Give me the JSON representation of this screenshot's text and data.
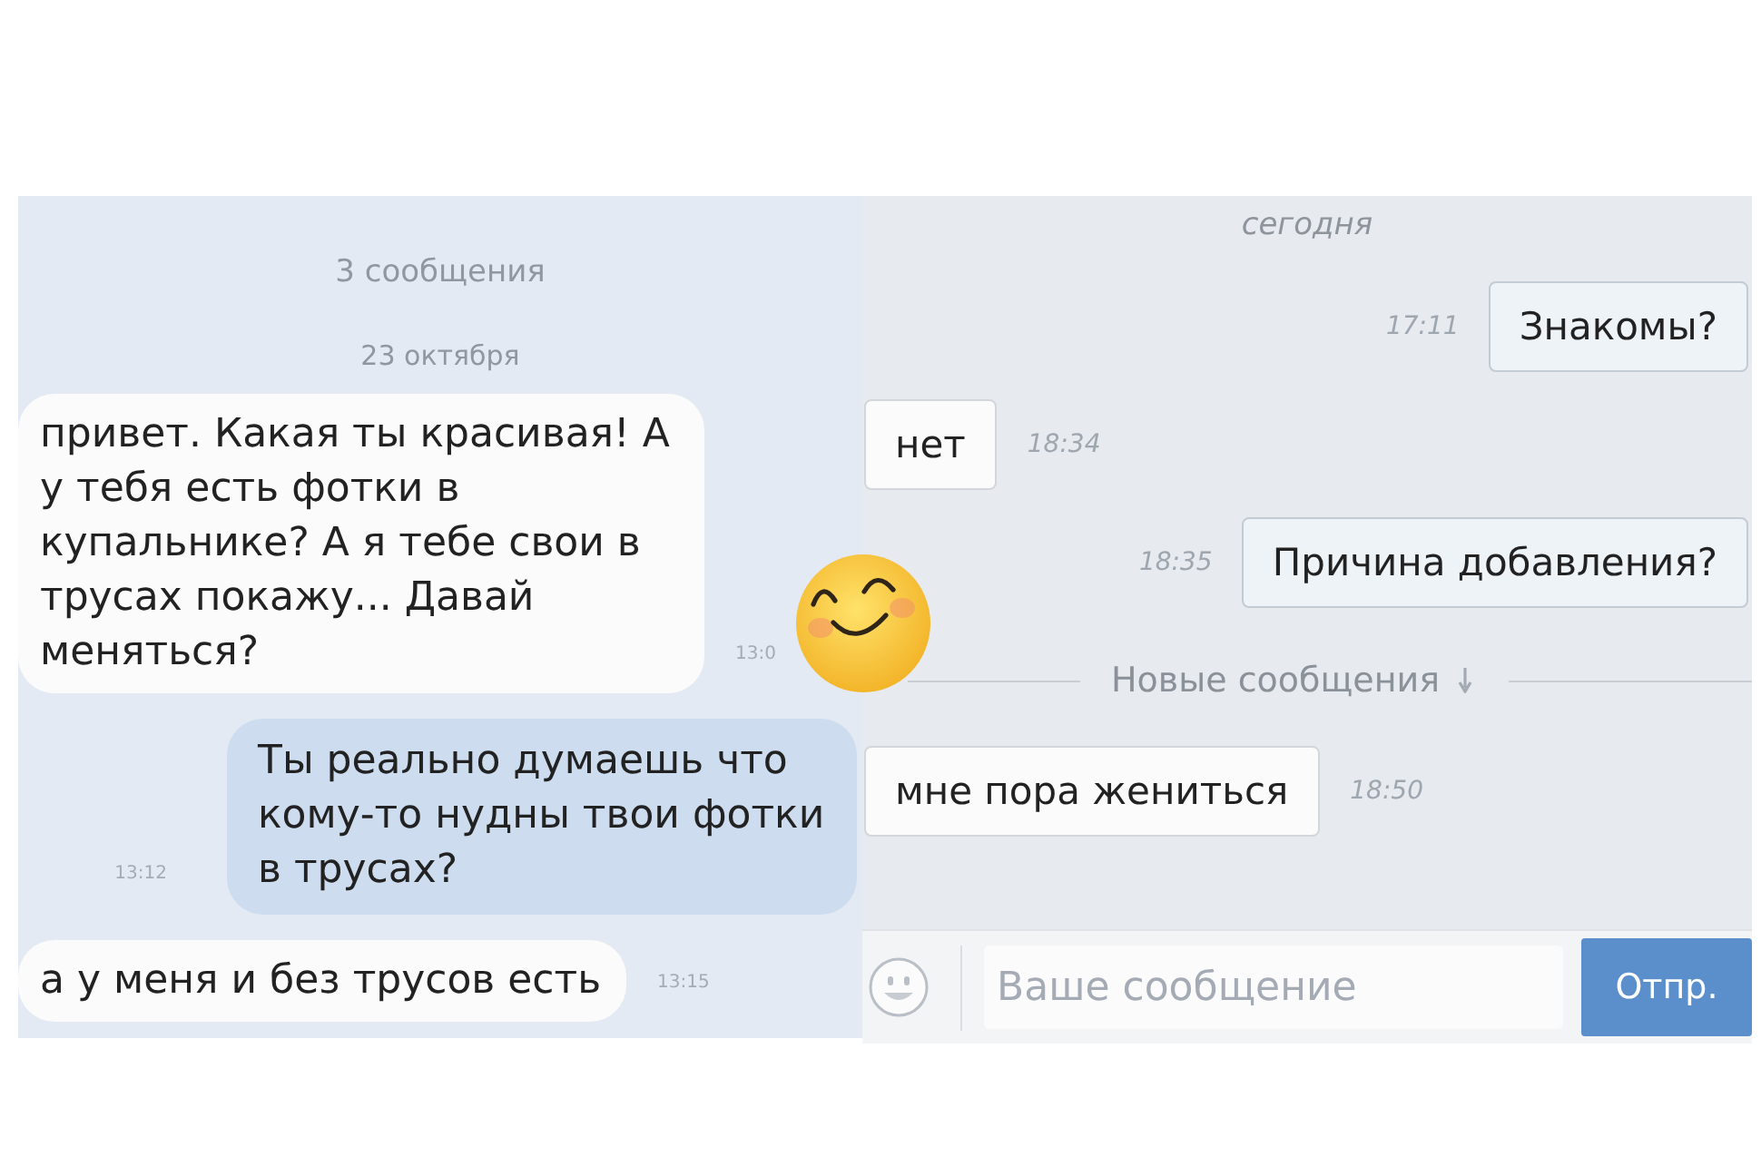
{
  "left_chat": {
    "header": "3 сообщения",
    "date": "23 октября",
    "messages": [
      {
        "kind": "incoming",
        "text": "привет. Какая ты красивая! А у тебя есть фотки в купальнике? А я тебе свои в трусах покажу... Давай меняться?",
        "time": "13:0"
      },
      {
        "kind": "outgoing",
        "text": "Ты реально думаешь что кому-то нудны твои фотки в трусах?",
        "time": "13:12"
      },
      {
        "kind": "incoming",
        "text": "а у меня и без трусов есть",
        "time": "13:15"
      }
    ]
  },
  "right_chat": {
    "date": "сегодня",
    "items": [
      {
        "kind": "outgoing",
        "text": "Знакомы?",
        "time": "17:11"
      },
      {
        "kind": "incoming",
        "text": "нет",
        "time": "18:34"
      },
      {
        "kind": "outgoing",
        "text": "Причина добавления?",
        "time": "18:35"
      },
      {
        "kind": "divider",
        "text": "Новые сообщения"
      },
      {
        "kind": "incoming",
        "text": "мне пора жениться",
        "time": "18:50"
      }
    ],
    "composer": {
      "placeholder": "Ваше сообщение",
      "send_button": "Отпр."
    }
  }
}
